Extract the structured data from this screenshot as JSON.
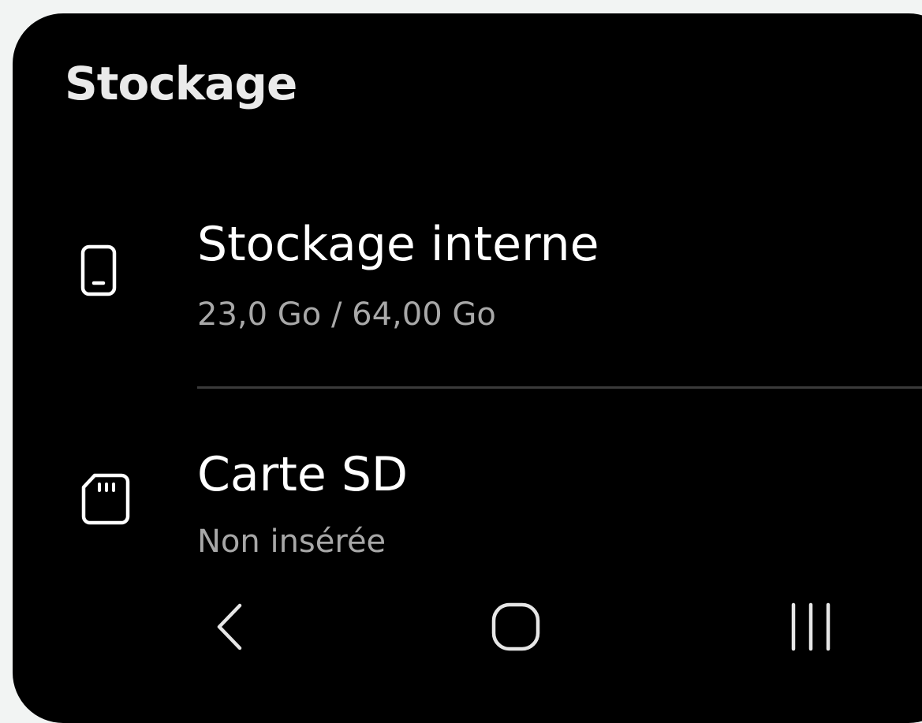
{
  "header": {
    "title": "Stockage"
  },
  "storage_items": [
    {
      "icon": "phone-icon",
      "title": "Stockage interne",
      "subtitle": "23,0 Go / 64,00 Go",
      "used_gb": 23.0,
      "total_gb": 64.0
    },
    {
      "icon": "sd-card-icon",
      "title": "Carte SD",
      "subtitle": "Non insérée"
    }
  ],
  "navbar": {
    "buttons": [
      "back-icon",
      "home-icon",
      "recents-icon"
    ]
  },
  "colors": {
    "background": "#000000",
    "frame": "#f2f4f3",
    "title_text": "#eaeaea",
    "primary_text": "#ffffff",
    "secondary_text": "#a8a8a8",
    "divider": "#3a3a3a"
  }
}
